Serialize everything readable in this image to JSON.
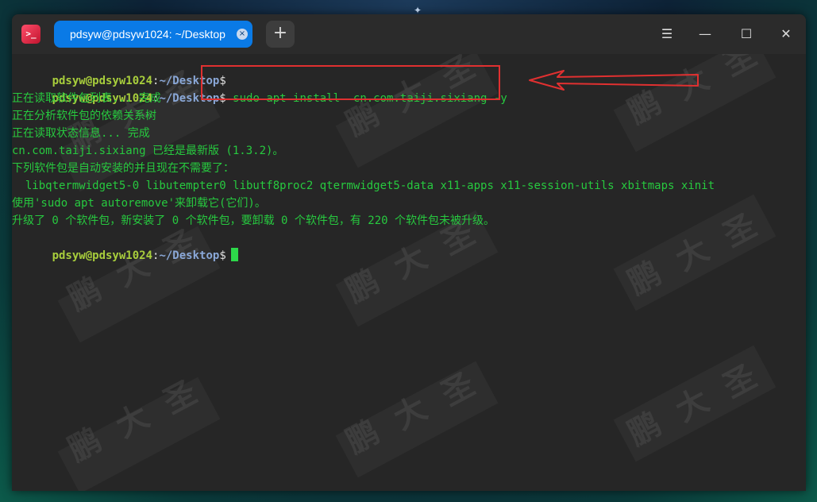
{
  "desktop": {
    "star_icon": "star-icon"
  },
  "window": {
    "app_icon_glyph": ">_",
    "tab": {
      "label": "pdsyw@pdsyw1024: ~/Desktop",
      "close_glyph": "×"
    },
    "new_tab_glyph": "+",
    "controls": {
      "menu_glyph": "☰",
      "minimize_glyph": "—",
      "maximize_glyph": "☐",
      "close_glyph": "✕"
    }
  },
  "terminal": {
    "prompt": {
      "user": "pdsyw@pdsyw1024",
      "colon": ":",
      "path": "~/Desktop",
      "dollar": "$"
    },
    "command": " sudo apt install  cn.com.taiji.sixiang -y",
    "output": [
      "正在读取软件包列表... 完成",
      "正在分析软件包的依赖关系树",
      "正在读取状态信息... 完成",
      "cn.com.taiji.sixiang 已经是最新版 (1.3.2)。",
      "下列软件包是自动安装的并且现在不需要了：",
      "  libqtermwidget5-0 libutempter0 libutf8proc2 qtermwidget5-data x11-apps x11-session-utils xbitmaps xinit",
      "使用'sudo apt autoremove'来卸载它(它们)。",
      "升级了 0 个软件包，新安装了 0 个软件包，要卸载 0 个软件包，有 220 个软件包未被升级。"
    ]
  },
  "watermark": {
    "chars": [
      "鹏",
      "大",
      "圣"
    ]
  },
  "colors": {
    "prompt_user": "#a8ce3c",
    "prompt_path": "#8aa8d8",
    "output_green": "#27c93f",
    "tab_active": "#0a7ae6",
    "highlight_red": "#e03030"
  }
}
